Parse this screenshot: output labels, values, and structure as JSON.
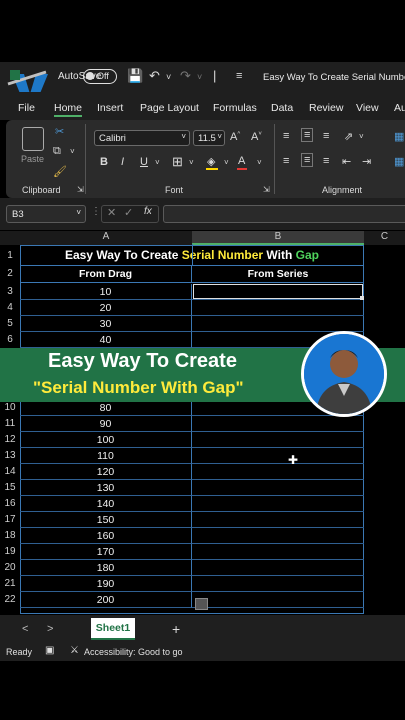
{
  "titlebar": {
    "autosave_label": "AutoSave",
    "toggle_state": "Off",
    "document_title": "Easy Way To Create Serial Number"
  },
  "tabs": [
    "File",
    "Home",
    "Insert",
    "Page Layout",
    "Formulas",
    "Data",
    "Review",
    "View",
    "Au"
  ],
  "ribbon": {
    "paste_label": "Paste",
    "font_name": "Calibri",
    "font_size": "11.5",
    "groups": {
      "clipboard": "Clipboard",
      "font": "Font",
      "alignment": "Alignment"
    },
    "bold": "B",
    "italic": "I",
    "underline": "U",
    "grow_font": "A^",
    "shrink_font": "A˅"
  },
  "formula_bar": {
    "name_box": "B3",
    "fx": "fx"
  },
  "columns": [
    "A",
    "B",
    "C"
  ],
  "sheet": {
    "title_parts": [
      "Easy Way To Create ",
      "Serial Number",
      " With ",
      "Gap"
    ],
    "header_a": "From Drag",
    "header_b": "From Series",
    "rows": [
      {
        "n": "3",
        "a": "10"
      },
      {
        "n": "4",
        "a": "20"
      },
      {
        "n": "5",
        "a": "30"
      },
      {
        "n": "6",
        "a": "40"
      },
      {
        "n": "10",
        "a": "80"
      },
      {
        "n": "11",
        "a": "90"
      },
      {
        "n": "12",
        "a": "100"
      },
      {
        "n": "13",
        "a": "110"
      },
      {
        "n": "14",
        "a": "120"
      },
      {
        "n": "15",
        "a": "130"
      },
      {
        "n": "16",
        "a": "140"
      },
      {
        "n": "17",
        "a": "150"
      },
      {
        "n": "18",
        "a": "160"
      },
      {
        "n": "19",
        "a": "170"
      },
      {
        "n": "20",
        "a": "180"
      },
      {
        "n": "21",
        "a": "190"
      },
      {
        "n": "22",
        "a": "200"
      }
    ],
    "header_row_numbers": [
      "1",
      "2"
    ]
  },
  "banner": {
    "line1": "Easy Way To Create",
    "line2": "\"Serial Number With Gap\""
  },
  "sheet_tabs": {
    "active": "Sheet1",
    "add": "+",
    "prev": "<",
    "next": ">"
  },
  "status": {
    "ready": "Ready",
    "accessibility": "Accessibility: Good to go"
  },
  "colors": {
    "excel_green": "#217346",
    "highlight_yellow": "#ffeb3b",
    "grid_blue": "#3b78b4"
  }
}
